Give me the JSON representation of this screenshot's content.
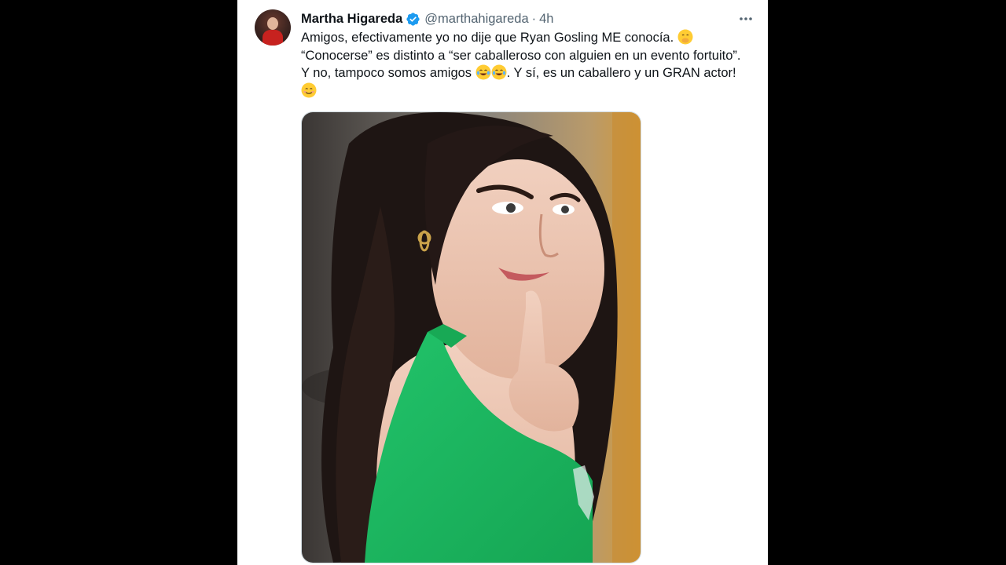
{
  "tweet": {
    "author_name": "Martha Higareda",
    "handle": "@marthahigareda",
    "separator": "·",
    "time": "4h",
    "lines": [
      "Amigos, efectivamente yo no dije que Ryan Gosling ME conocía.",
      "“Conocerse” es distinto a “ser caballeroso con alguien en un evento fortuito”. Y no, tampoco somos amigos",
      ". Y sí, es un caballero y un GRAN actor!"
    ],
    "emojis": {
      "line1": "face-with-hand-over-mouth",
      "line2": [
        "face-with-tears-of-joy",
        "face-with-tears-of-joy"
      ],
      "line3": "smiling-face-with-smiling-eyes"
    },
    "verified_badge": "verified-icon"
  },
  "colors": {
    "background": "#000000",
    "panel": "#ffffff",
    "text_primary": "#0f1419",
    "text_secondary": "#536471",
    "verified_blue": "#1d9bf0",
    "dress_green": "#1fb25a"
  }
}
